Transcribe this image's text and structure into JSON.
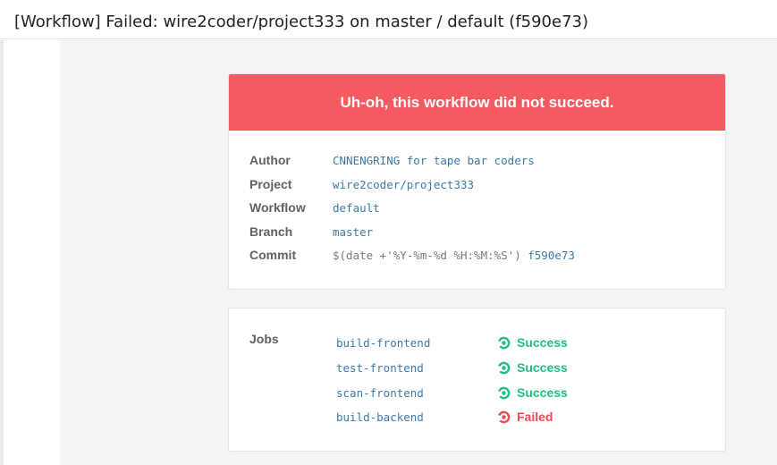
{
  "email": {
    "subject": "[Workflow] Failed: wire2coder/project333 on master / default (f590e73)",
    "banner": "Uh-oh, this workflow did not succeed.",
    "details": [
      {
        "label": "Author",
        "value": "CNNENGRING for tape bar coders"
      },
      {
        "label": "Project",
        "value": "wire2coder/project333"
      },
      {
        "label": "Workflow",
        "value": "default"
      },
      {
        "label": "Branch",
        "value": "master"
      },
      {
        "label": "Commit",
        "prefix": "$(date +'%Y-%m-%d %H:%M:%S')",
        "value": "f590e73"
      }
    ],
    "jobs_label": "Jobs",
    "jobs": [
      {
        "name": "build-frontend",
        "status": "Success"
      },
      {
        "name": "test-frontend",
        "status": "Success"
      },
      {
        "name": "scan-frontend",
        "status": "Success"
      },
      {
        "name": "build-backend",
        "status": "Failed"
      }
    ]
  },
  "colors": {
    "banner": "#f45b61",
    "success": "#24be7f",
    "failed": "#ef4b55",
    "link": "#3b7aa8"
  }
}
